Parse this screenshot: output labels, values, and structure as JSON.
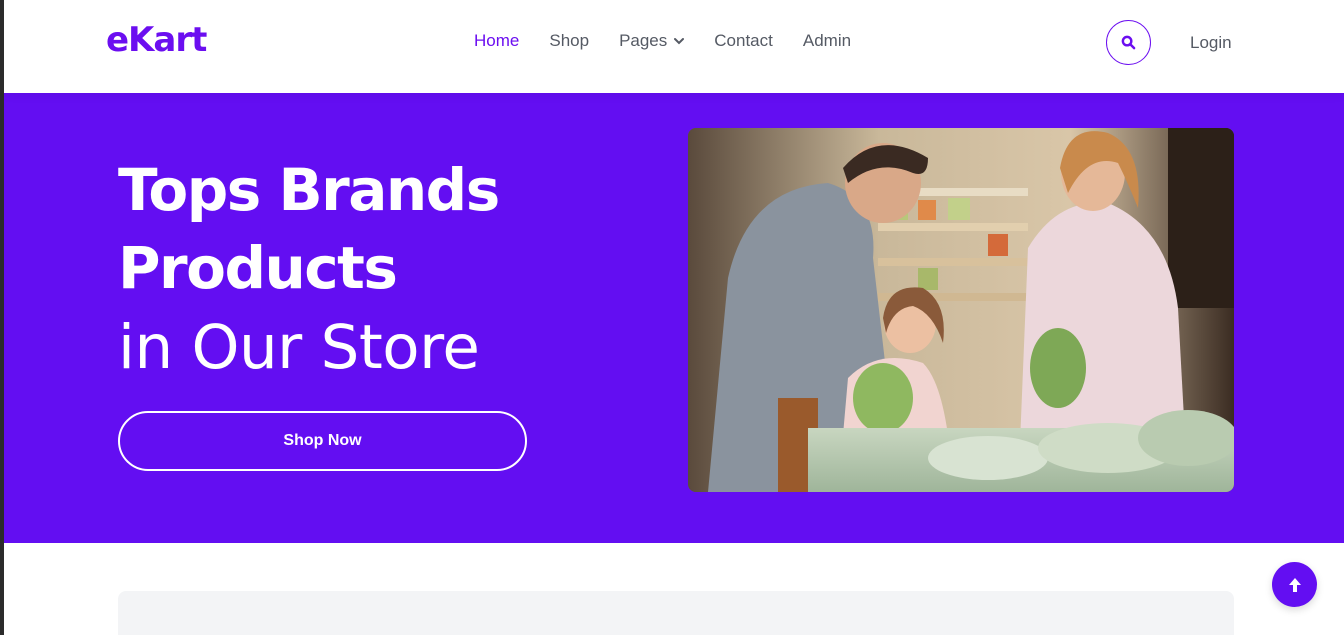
{
  "header": {
    "logo": "eKart",
    "nav": [
      {
        "label": "Home",
        "active": true
      },
      {
        "label": "Shop",
        "active": false
      },
      {
        "label": "Pages",
        "active": false,
        "dropdown": true
      },
      {
        "label": "Contact",
        "active": false
      },
      {
        "label": "Admin",
        "active": false
      }
    ],
    "search_icon": "search-icon",
    "login": "Login"
  },
  "hero": {
    "title_line1": "Tops Brands",
    "title_line2": "Products",
    "subtitle": "in Our Store",
    "button": "Shop Now",
    "image_alt": "family shopping for vegetables in a grocery store"
  },
  "scroll_top_icon": "arrow-up-icon",
  "colors": {
    "accent": "#630ef2",
    "text_muted": "#555a64",
    "white": "#ffffff"
  }
}
